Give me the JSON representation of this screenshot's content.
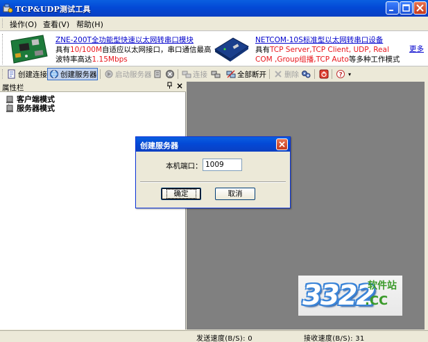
{
  "window": {
    "title": "TCP&UDP测试工具"
  },
  "menu": [
    {
      "label": "操作(O)"
    },
    {
      "label": "查看(V)"
    },
    {
      "label": "帮助(H)"
    }
  ],
  "banner": {
    "ad1": {
      "title": "ZNE-200T全功能型快速以太网转串口模块",
      "line1_pre": "具有",
      "line1_red": "10/100M",
      "line1_post": "自适应以太网接口，串口通信最高",
      "line2_pre": "波特率高达",
      "line2_red": "1.15Mbps"
    },
    "ad2": {
      "title": "NETCOM-10S标准型以太网转串口设备",
      "line1_pre": "具有",
      "line1_red": "TCP Server,TCP Client, UDP, Real",
      "line2_red": "COM ,Group组播,TCP Auto",
      "line2_post": "等多种工作模式"
    },
    "more": "更多"
  },
  "toolbar": {
    "create_conn": "创建连接",
    "create_server": "创建服务器",
    "start_server": "启动服务器",
    "connect": "连接",
    "disconnect_all": "全部断开",
    "delete": "删除"
  },
  "panel": {
    "title": "属性栏",
    "pin": "ᵖ",
    "close": "×",
    "tree": [
      {
        "label": "客户端模式"
      },
      {
        "label": "服务器模式"
      }
    ]
  },
  "dialog": {
    "title": "创建服务器",
    "port_label": "本机端口：",
    "port_value": "1009",
    "ok": "确定",
    "cancel": "取消"
  },
  "status": {
    "send": "发送速度(B/S): 0",
    "recv": "接收速度(B/S): 31"
  },
  "watermark": {
    "number": "3322",
    "site": "软件站",
    "domain": ".CC"
  },
  "colors": {
    "titlebar": "#0349d6",
    "link": "#0000cc",
    "highlight": "#e8151b",
    "main_bg": "#808080"
  }
}
